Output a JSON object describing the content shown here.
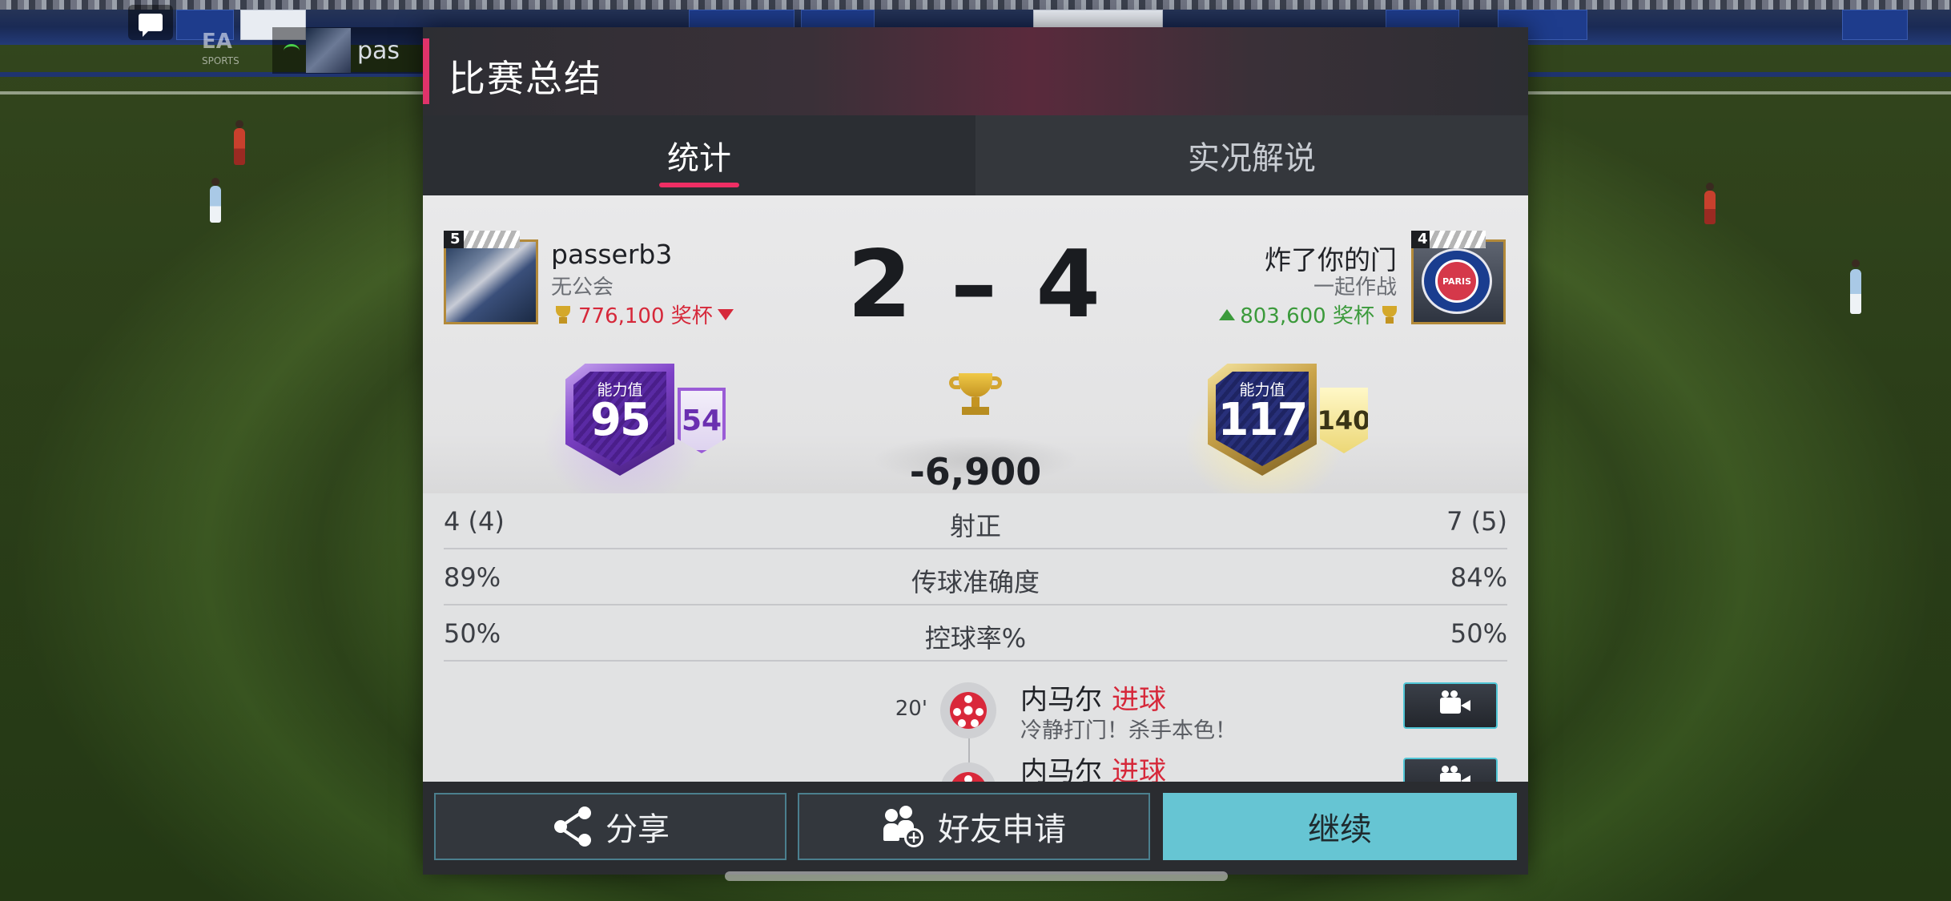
{
  "dialog": {
    "title": "比赛总结",
    "tabs": [
      {
        "label": "统计",
        "active": true
      },
      {
        "label": "实况解说",
        "active": false
      }
    ]
  },
  "match": {
    "home": {
      "name": "passerb3",
      "club": "无公会",
      "level": "5",
      "trophies": "776,100 奖杯",
      "trophy_trend": "down",
      "rating_label": "能力值",
      "rating": "95",
      "sub_rating": "54"
    },
    "away": {
      "name": "炸了你的门",
      "club": "一起作战",
      "level": "4",
      "trophies": "803,600 奖杯",
      "trophy_trend": "up",
      "rating_label": "能力值",
      "rating": "117",
      "sub_rating": "140",
      "crest_text": "PARIS"
    },
    "score": "2 – 4",
    "trophy_delta": "-6,900"
  },
  "stats": [
    {
      "left": "4 (4)",
      "label": "射正",
      "right": "7 (5)"
    },
    {
      "left": "89%",
      "label": "传球准确度",
      "right": "84%"
    },
    {
      "left": "50%",
      "label": "控球率%",
      "right": "50%"
    }
  ],
  "events": [
    {
      "minute": "20'",
      "player": "内马尔",
      "type": "进球",
      "description": "冷静打门！杀手本色！"
    },
    {
      "minute": "",
      "player": "内马尔",
      "type": "进球",
      "description": ""
    }
  ],
  "footer": {
    "share_label": "分享",
    "friend_label": "好友申请",
    "continue_label": "继续"
  },
  "background": {
    "hud_name": "pas",
    "logo": "EA",
    "logo_sub": "SPORTS"
  },
  "colors": {
    "accent_pink": "#ef2e64",
    "continue_button": "#66c5d3",
    "loss_red": "#d6283a",
    "gain_green": "#3b9a3b"
  }
}
